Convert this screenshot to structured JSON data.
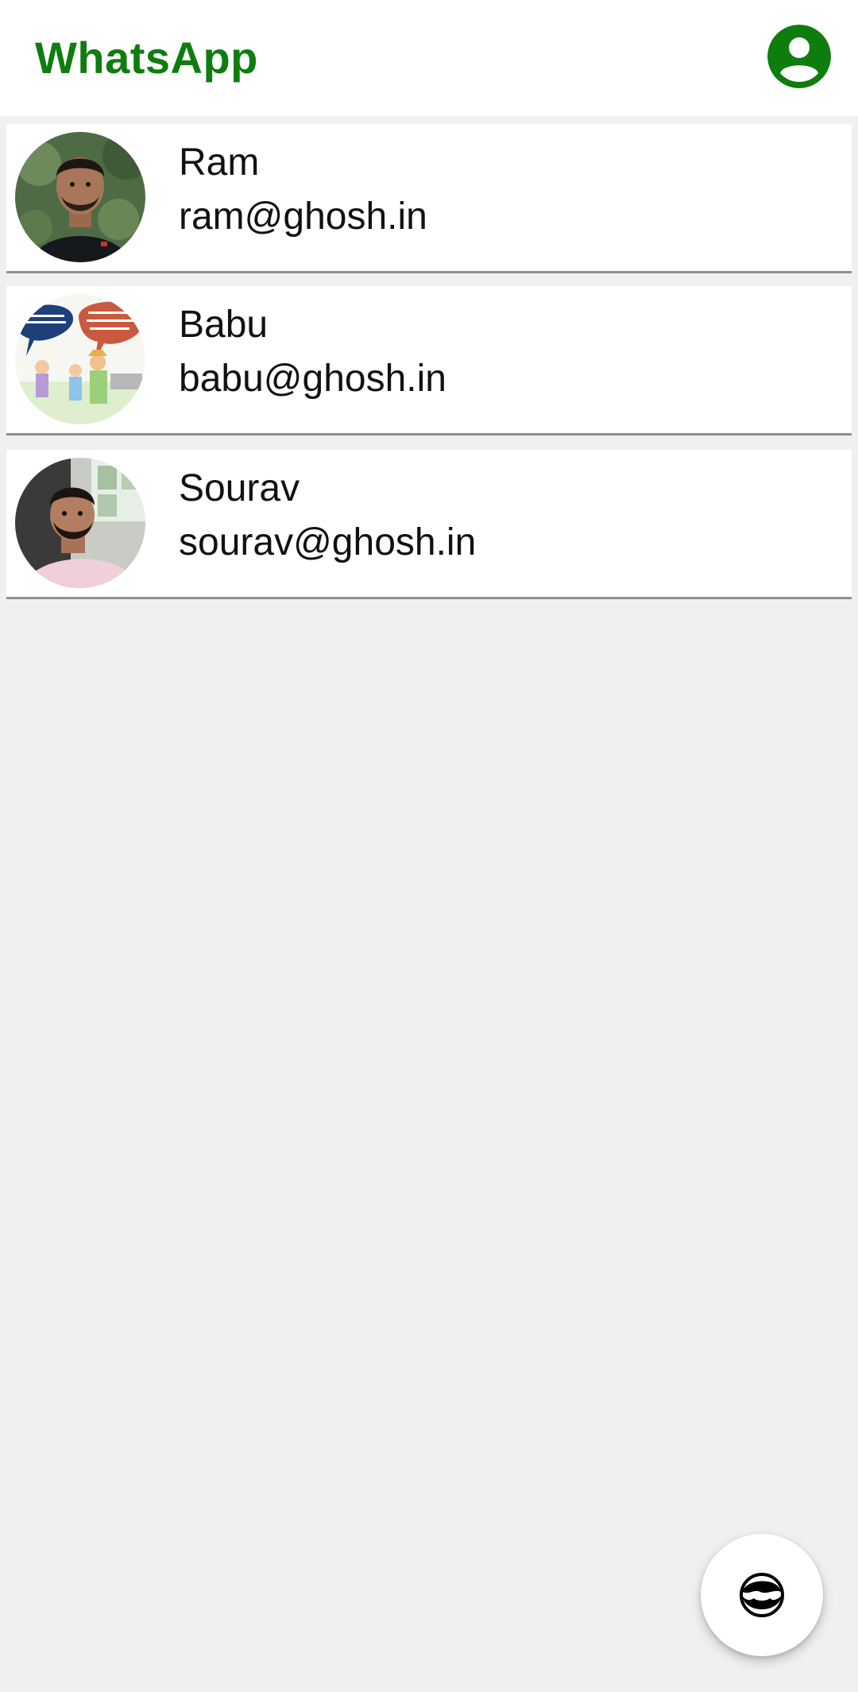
{
  "app_bar": {
    "title": "WhatsApp",
    "account_icon": "account-circle-icon",
    "accent_color": "#0e7d0e"
  },
  "contacts": [
    {
      "name": "Ram",
      "email": "ram@ghosh.in",
      "avatar": "profile-photo"
    },
    {
      "name": "Babu",
      "email": "babu@ghosh.in",
      "avatar": "cartoon-illustration"
    },
    {
      "name": "Sourav",
      "email": "sourav@ghosh.in",
      "avatar": "profile-photo"
    }
  ],
  "fab": {
    "icon": "face-icon"
  },
  "colors": {
    "background": "#f0f0f0",
    "card": "#ffffff",
    "divider": "#8f8f8f"
  }
}
